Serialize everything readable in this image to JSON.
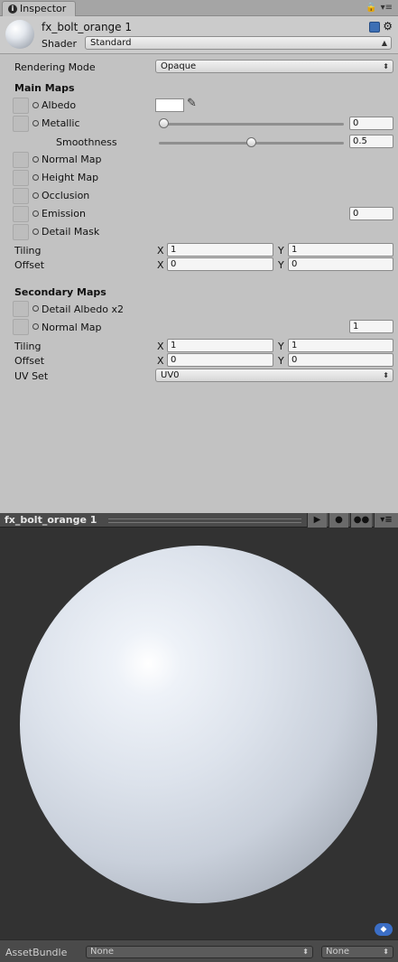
{
  "tab": {
    "label": "Inspector"
  },
  "header": {
    "material_name": "fx_bolt_orange 1",
    "shader_label": "Shader",
    "shader_value": "Standard"
  },
  "rendering_mode": {
    "label": "Rendering Mode",
    "value": "Opaque"
  },
  "main_maps": {
    "title": "Main Maps",
    "albedo": {
      "label": "Albedo",
      "color": "#ffffff"
    },
    "metallic": {
      "label": "Metallic",
      "value": "0",
      "fraction": 0
    },
    "smoothness": {
      "label": "Smoothness",
      "value": "0.5",
      "fraction": 0.5
    },
    "normal_map": {
      "label": "Normal Map"
    },
    "height_map": {
      "label": "Height Map"
    },
    "occlusion": {
      "label": "Occlusion"
    },
    "emission": {
      "label": "Emission",
      "value": "0"
    },
    "detail_mask": {
      "label": "Detail Mask"
    },
    "tiling": {
      "label": "Tiling",
      "x_label": "X",
      "x": "1",
      "y_label": "Y",
      "y": "1"
    },
    "offset": {
      "label": "Offset",
      "x_label": "X",
      "x": "0",
      "y_label": "Y",
      "y": "0"
    }
  },
  "secondary_maps": {
    "title": "Secondary Maps",
    "detail_albedo": {
      "label": "Detail Albedo x2"
    },
    "normal_map": {
      "label": "Normal Map",
      "value": "1"
    },
    "tiling": {
      "label": "Tiling",
      "x_label": "X",
      "x": "1",
      "y_label": "Y",
      "y": "1"
    },
    "offset": {
      "label": "Offset",
      "x_label": "X",
      "x": "0",
      "y_label": "Y",
      "y": "0"
    },
    "uv_set": {
      "label": "UV Set",
      "value": "UV0"
    }
  },
  "preview": {
    "title": "fx_bolt_orange 1"
  },
  "asset_bundle": {
    "label": "AssetBundle",
    "bundle_value": "None",
    "variant_value": "None"
  }
}
